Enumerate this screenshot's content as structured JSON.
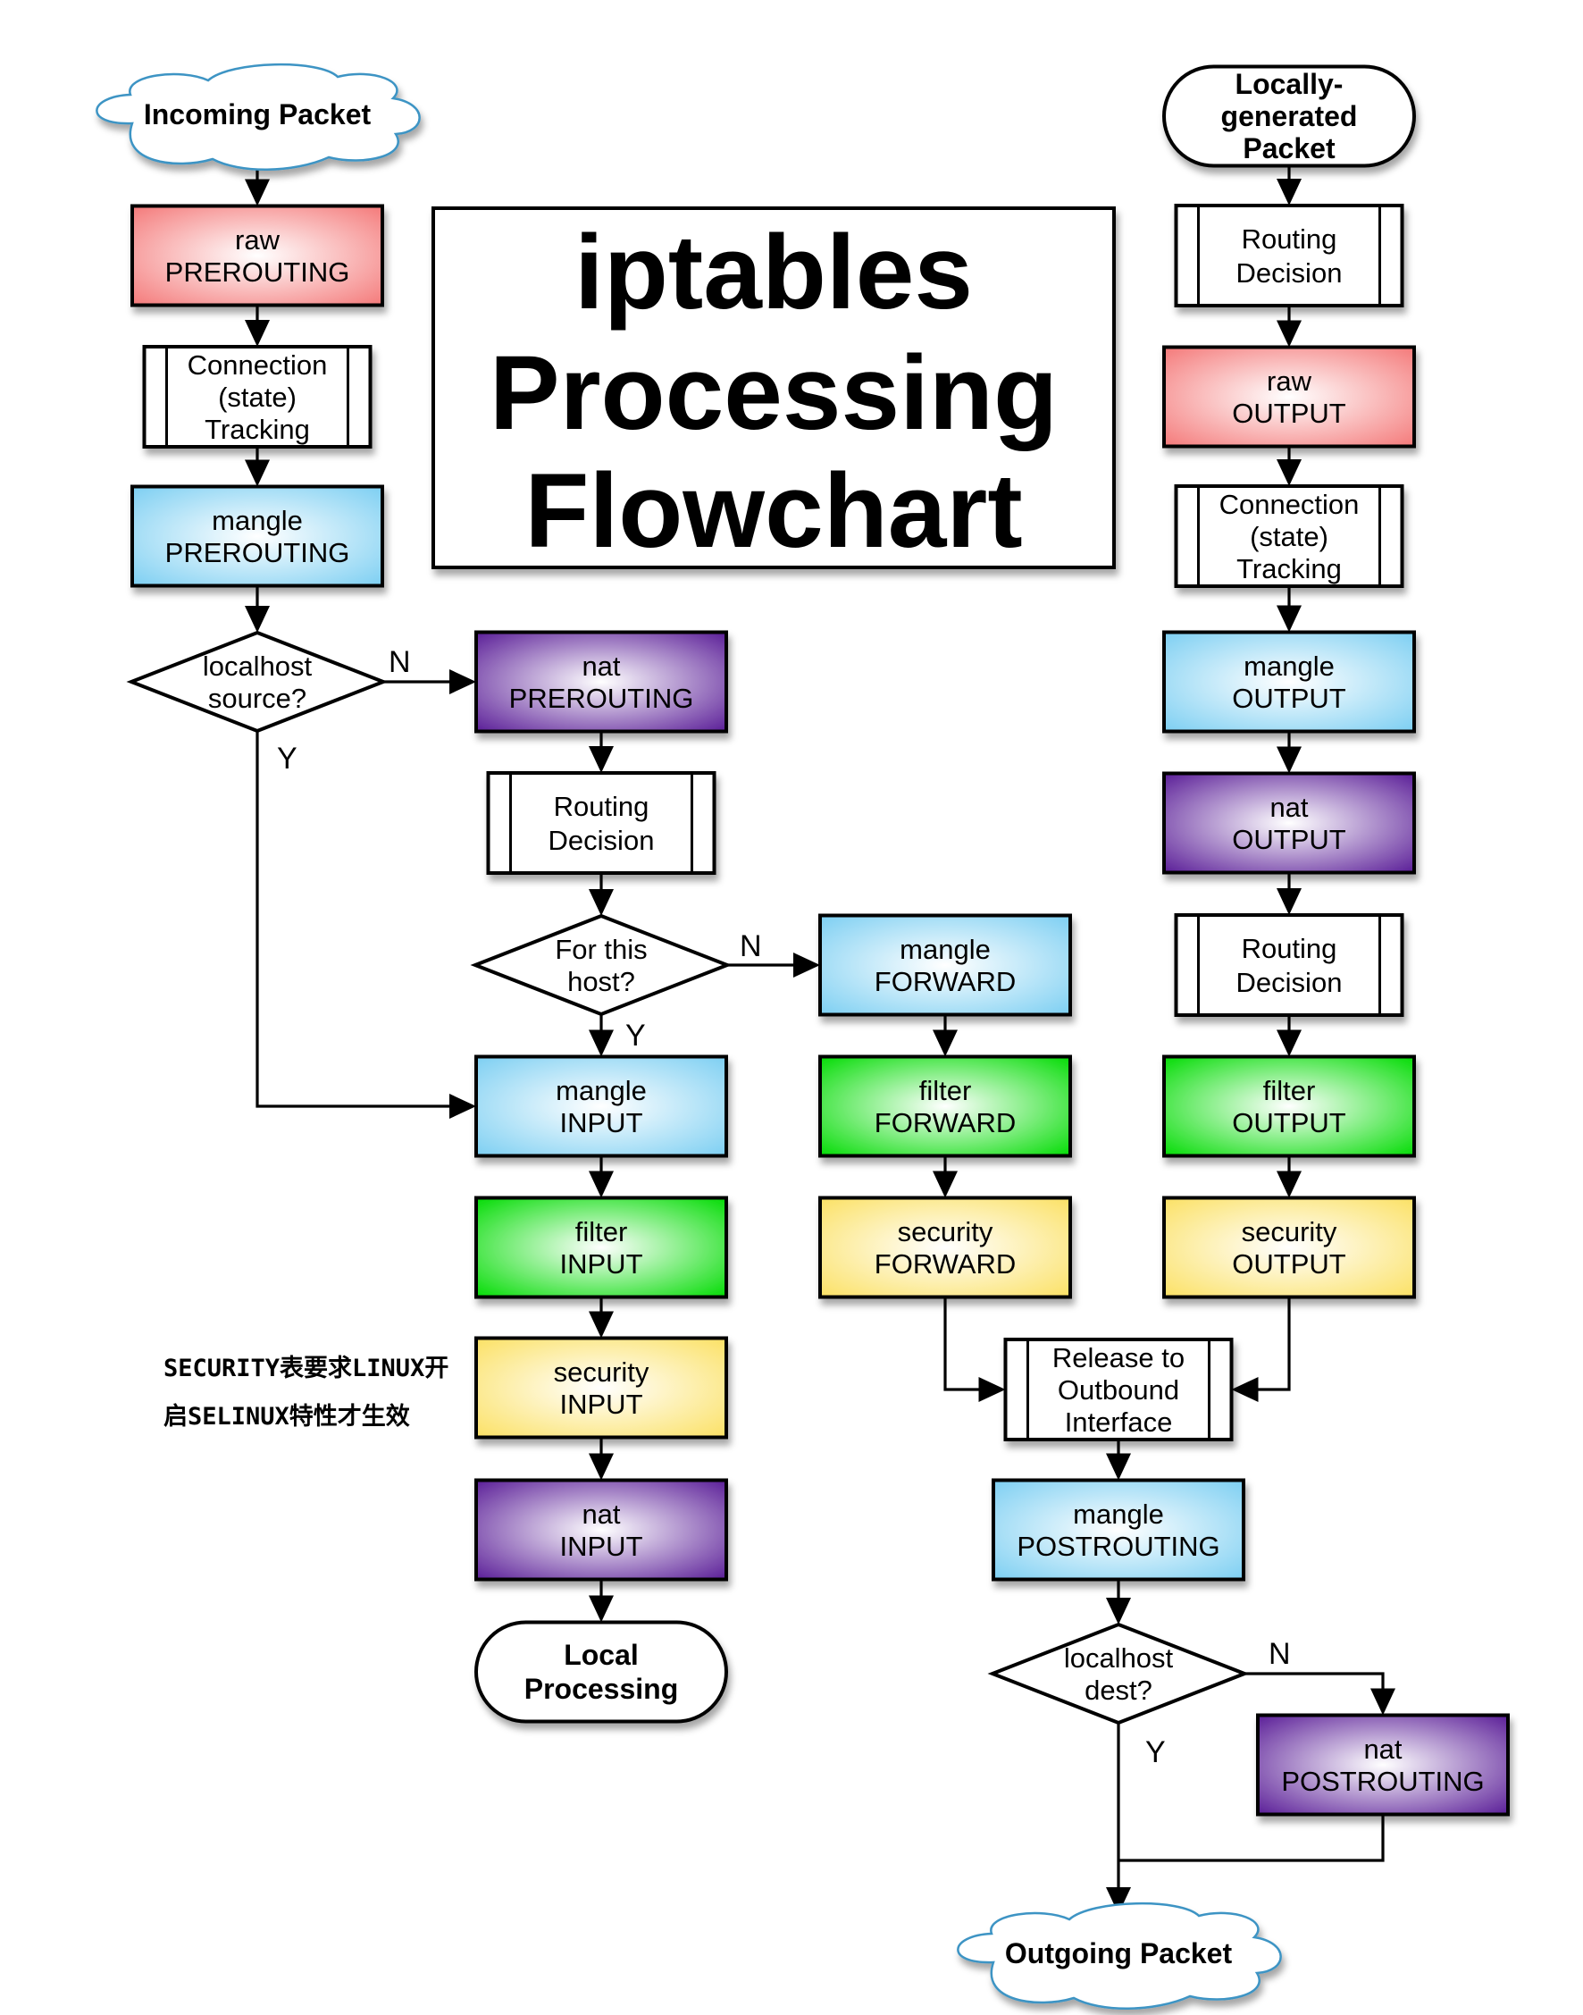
{
  "title": {
    "lines": [
      "iptables",
      "Processing",
      "Flowchart"
    ]
  },
  "table_colors": {
    "raw": "#f47a7a",
    "mangle": "#7dcff2",
    "nat": "#6a2fa0",
    "filter": "#11e012",
    "security": "#fbe56c"
  },
  "nodes": [
    {
      "id": "incoming",
      "kind": "cloud",
      "lines": [
        "Incoming Packet"
      ]
    },
    {
      "id": "raw_pre",
      "kind": "table",
      "table": "raw",
      "lines": [
        "raw",
        "PREROUTING"
      ]
    },
    {
      "id": "conntrack_in",
      "kind": "process",
      "lines": [
        "Connection",
        "(state)",
        "Tracking"
      ]
    },
    {
      "id": "mangle_pre",
      "kind": "table",
      "table": "mangle",
      "lines": [
        "mangle",
        "PREROUTING"
      ]
    },
    {
      "id": "localhost_src",
      "kind": "decision",
      "lines": [
        "localhost",
        "source?"
      ]
    },
    {
      "id": "nat_pre",
      "kind": "table",
      "table": "nat",
      "lines": [
        "nat",
        "PREROUTING"
      ]
    },
    {
      "id": "routing_in",
      "kind": "process",
      "lines": [
        "Routing",
        "Decision"
      ]
    },
    {
      "id": "for_this_host",
      "kind": "decision",
      "lines": [
        "For this",
        "host?"
      ]
    },
    {
      "id": "mangle_input",
      "kind": "table",
      "table": "mangle",
      "lines": [
        "mangle",
        "INPUT"
      ]
    },
    {
      "id": "filter_input",
      "kind": "table",
      "table": "filter",
      "lines": [
        "filter",
        "INPUT"
      ]
    },
    {
      "id": "security_input",
      "kind": "table",
      "table": "security",
      "lines": [
        "security",
        "INPUT"
      ]
    },
    {
      "id": "nat_input",
      "kind": "table",
      "table": "nat",
      "lines": [
        "nat",
        "INPUT"
      ]
    },
    {
      "id": "local_processing",
      "kind": "terminal",
      "lines": [
        "Local",
        "Processing"
      ]
    },
    {
      "id": "mangle_forward",
      "kind": "table",
      "table": "mangle",
      "lines": [
        "mangle",
        "FORWARD"
      ]
    },
    {
      "id": "filter_forward",
      "kind": "table",
      "table": "filter",
      "lines": [
        "filter",
        "FORWARD"
      ]
    },
    {
      "id": "security_forward",
      "kind": "table",
      "table": "security",
      "lines": [
        "security",
        "FORWARD"
      ]
    },
    {
      "id": "locally_generated",
      "kind": "terminal",
      "lines": [
        "Locally-",
        "generated",
        "Packet"
      ]
    },
    {
      "id": "routing_out1",
      "kind": "process",
      "lines": [
        "Routing",
        "Decision"
      ]
    },
    {
      "id": "raw_output",
      "kind": "table",
      "table": "raw",
      "lines": [
        "raw",
        "OUTPUT"
      ]
    },
    {
      "id": "conntrack_out",
      "kind": "process",
      "lines": [
        "Connection",
        "(state)",
        "Tracking"
      ]
    },
    {
      "id": "mangle_output",
      "kind": "table",
      "table": "mangle",
      "lines": [
        "mangle",
        "OUTPUT"
      ]
    },
    {
      "id": "nat_output",
      "kind": "table",
      "table": "nat",
      "lines": [
        "nat",
        "OUTPUT"
      ]
    },
    {
      "id": "routing_out2",
      "kind": "process",
      "lines": [
        "Routing",
        "Decision"
      ]
    },
    {
      "id": "filter_output",
      "kind": "table",
      "table": "filter",
      "lines": [
        "filter",
        "OUTPUT"
      ]
    },
    {
      "id": "security_output",
      "kind": "table",
      "table": "security",
      "lines": [
        "security",
        "OUTPUT"
      ]
    },
    {
      "id": "release_outbound",
      "kind": "process",
      "lines": [
        "Release to",
        "Outbound",
        "Interface"
      ]
    },
    {
      "id": "mangle_post",
      "kind": "table",
      "table": "mangle",
      "lines": [
        "mangle",
        "POSTROUTING"
      ]
    },
    {
      "id": "localhost_dest",
      "kind": "decision",
      "lines": [
        "localhost",
        "dest?"
      ]
    },
    {
      "id": "nat_post",
      "kind": "table",
      "table": "nat",
      "lines": [
        "nat",
        "POSTROUTING"
      ]
    },
    {
      "id": "outgoing",
      "kind": "cloud",
      "lines": [
        "Outgoing Packet"
      ]
    }
  ],
  "edges": [
    {
      "from": "incoming",
      "to": "raw_pre"
    },
    {
      "from": "raw_pre",
      "to": "conntrack_in"
    },
    {
      "from": "conntrack_in",
      "to": "mangle_pre"
    },
    {
      "from": "mangle_pre",
      "to": "localhost_src"
    },
    {
      "from": "localhost_src",
      "to": "nat_pre",
      "label": "N"
    },
    {
      "from": "localhost_src",
      "to": "mangle_input",
      "label": "Y"
    },
    {
      "from": "nat_pre",
      "to": "routing_in"
    },
    {
      "from": "routing_in",
      "to": "for_this_host"
    },
    {
      "from": "for_this_host",
      "to": "mangle_forward",
      "label": "N"
    },
    {
      "from": "for_this_host",
      "to": "mangle_input",
      "label": "Y"
    },
    {
      "from": "mangle_input",
      "to": "filter_input"
    },
    {
      "from": "filter_input",
      "to": "security_input"
    },
    {
      "from": "security_input",
      "to": "nat_input"
    },
    {
      "from": "nat_input",
      "to": "local_processing"
    },
    {
      "from": "mangle_forward",
      "to": "filter_forward"
    },
    {
      "from": "filter_forward",
      "to": "security_forward"
    },
    {
      "from": "security_forward",
      "to": "release_outbound"
    },
    {
      "from": "locally_generated",
      "to": "routing_out1"
    },
    {
      "from": "routing_out1",
      "to": "raw_output"
    },
    {
      "from": "raw_output",
      "to": "conntrack_out"
    },
    {
      "from": "conntrack_out",
      "to": "mangle_output"
    },
    {
      "from": "mangle_output",
      "to": "nat_output"
    },
    {
      "from": "nat_output",
      "to": "routing_out2"
    },
    {
      "from": "routing_out2",
      "to": "filter_output"
    },
    {
      "from": "filter_output",
      "to": "security_output"
    },
    {
      "from": "security_output",
      "to": "release_outbound"
    },
    {
      "from": "release_outbound",
      "to": "mangle_post"
    },
    {
      "from": "mangle_post",
      "to": "localhost_dest"
    },
    {
      "from": "localhost_dest",
      "to": "nat_post",
      "label": "N"
    },
    {
      "from": "localhost_dest",
      "to": "outgoing",
      "label": "Y"
    },
    {
      "from": "nat_post",
      "to": "outgoing"
    }
  ],
  "annotation": {
    "lines": [
      "SECURITY表要求LINUX开",
      "启SELINUX特性才生效"
    ]
  }
}
